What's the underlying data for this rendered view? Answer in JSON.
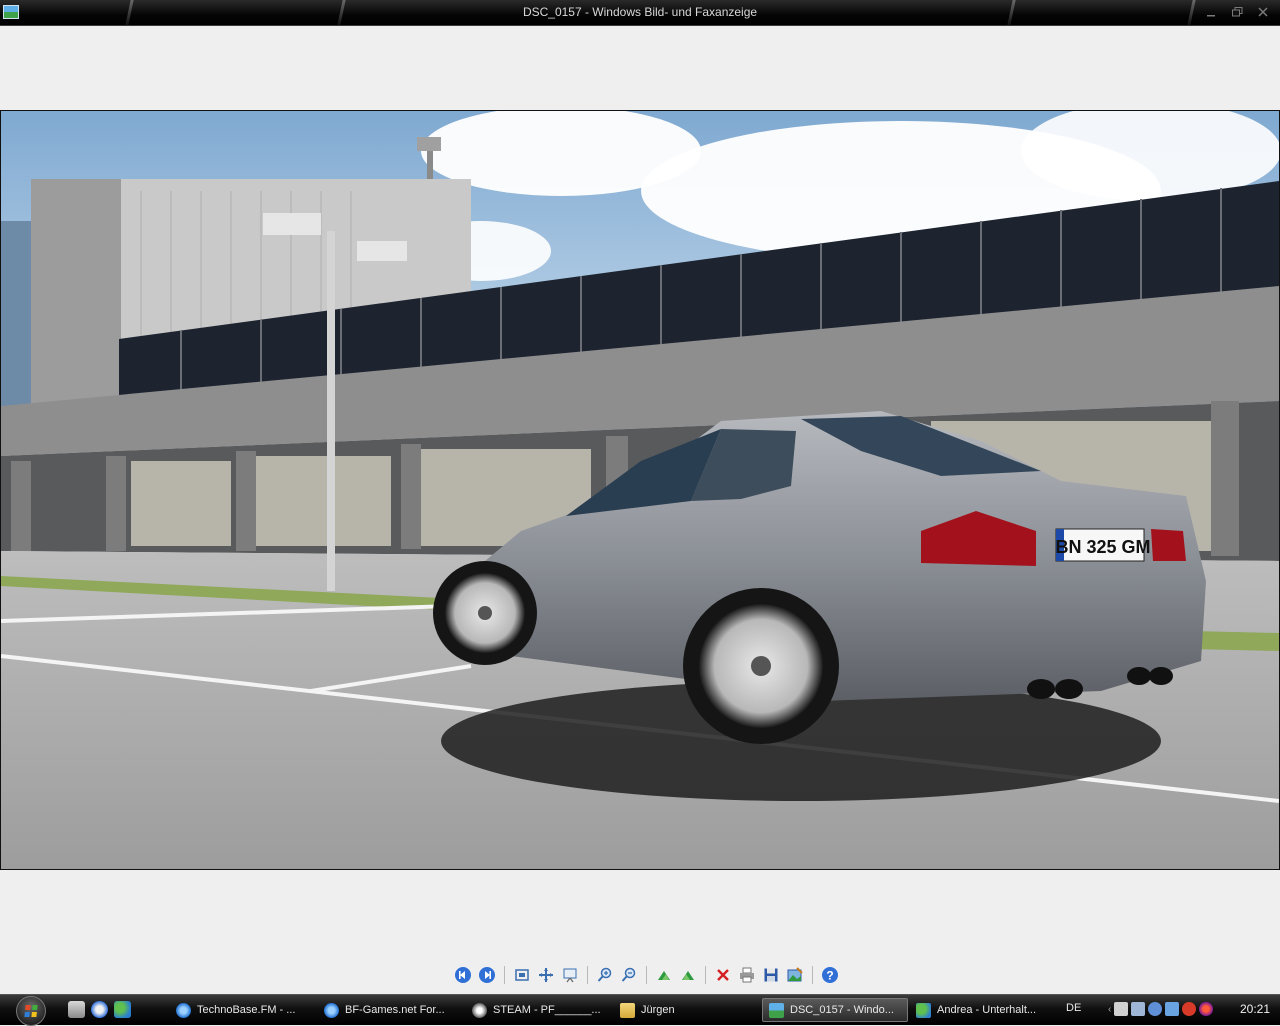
{
  "window": {
    "title": "DSC_0157 - Windows Bild- und Faxanzeige",
    "icon": "photo-viewer-icon",
    "controls": [
      "minimize-icon",
      "maximize-icon",
      "close-icon"
    ]
  },
  "photo": {
    "description_icon": "photo-content",
    "license_plate": "BN 325 GM"
  },
  "toolbar": {
    "buttons": [
      {
        "name": "previous-image-button",
        "icon": "previous-arrow-icon"
      },
      {
        "name": "next-image-button",
        "icon": "next-arrow-icon"
      },
      {
        "name": "best-fit-button",
        "icon": "best-fit-icon"
      },
      {
        "name": "actual-size-button",
        "icon": "actual-size-icon"
      },
      {
        "name": "slideshow-button",
        "icon": "slideshow-icon"
      },
      {
        "name": "zoom-in-button",
        "icon": "zoom-in-icon"
      },
      {
        "name": "zoom-out-button",
        "icon": "zoom-out-icon"
      },
      {
        "name": "rotate-clockwise-button",
        "icon": "rotate-cw-icon"
      },
      {
        "name": "rotate-counterclockwise-button",
        "icon": "rotate-ccw-icon"
      },
      {
        "name": "delete-button",
        "icon": "delete-x-icon"
      },
      {
        "name": "print-button",
        "icon": "printer-icon"
      },
      {
        "name": "save-button",
        "icon": "floppy-disk-icon"
      },
      {
        "name": "edit-button",
        "icon": "edit-image-icon"
      },
      {
        "name": "help-button",
        "icon": "help-icon"
      }
    ]
  },
  "taskbar": {
    "tasks": [
      {
        "label": "TechnoBase.FM - ...",
        "icon": "ie-icon"
      },
      {
        "label": "BF-Games.net For...",
        "icon": "ie-icon"
      },
      {
        "label": "STEAM - PF______...",
        "icon": "steam-icon"
      },
      {
        "label": "Jürgen",
        "icon": "folder-icon"
      },
      {
        "label": "DSC_0157 - Windo...",
        "icon": "photo-viewer-icon"
      },
      {
        "label": "Andrea - Unterhalt...",
        "icon": "messenger-icon"
      }
    ],
    "language": "DE",
    "clock": "20:21"
  },
  "colors": {
    "titlebar": "#000000",
    "viewer_bg": "#efefef",
    "taskbar": "#101010"
  }
}
